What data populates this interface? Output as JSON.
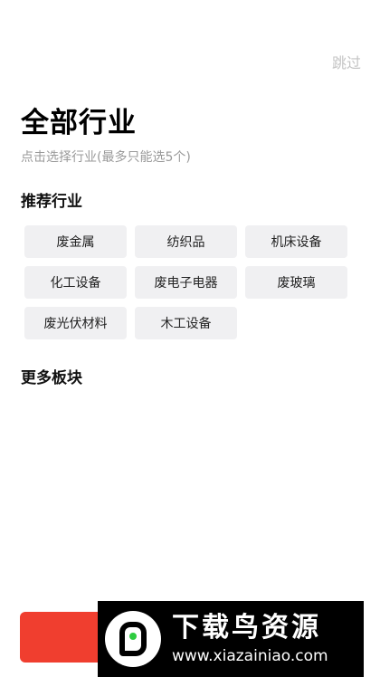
{
  "header": {
    "skip_label": "跳过"
  },
  "page": {
    "title": "全部行业",
    "subtitle": "点击选择行业(最多只能选5个)"
  },
  "recommended": {
    "title": "推荐行业",
    "tags": [
      "废金属",
      "纺织品",
      "机床设备",
      "化工设备",
      "废电子电器",
      "废玻璃",
      "废光伏材料",
      "木工设备"
    ]
  },
  "more": {
    "title": "更多板块"
  },
  "bottom_button": {
    "label": "",
    "color": "#f03e2f"
  },
  "watermark": {
    "title": "下载鸟资源",
    "url": "www.xiazainiao.com"
  }
}
